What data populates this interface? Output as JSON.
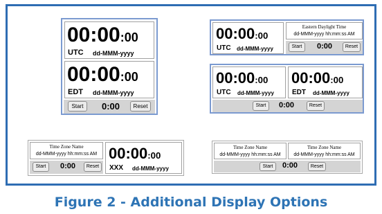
{
  "caption": "Figure 2 - Additional Display Options",
  "clock": {
    "time_main": "00:00",
    "time_sec": ":00",
    "date_format": "dd-MMM-yyyy",
    "datetime_format": "dd-MMM-yyyy hh:mm:ss AM"
  },
  "zones": {
    "utc": "UTC",
    "edt": "EDT",
    "xxx": "XXX",
    "eastern_name": "Eastern Daylight Time",
    "placeholder_name": "Time Zone Name"
  },
  "controls": {
    "start": "Start",
    "reset": "Reset",
    "elapsed": "0:00"
  }
}
